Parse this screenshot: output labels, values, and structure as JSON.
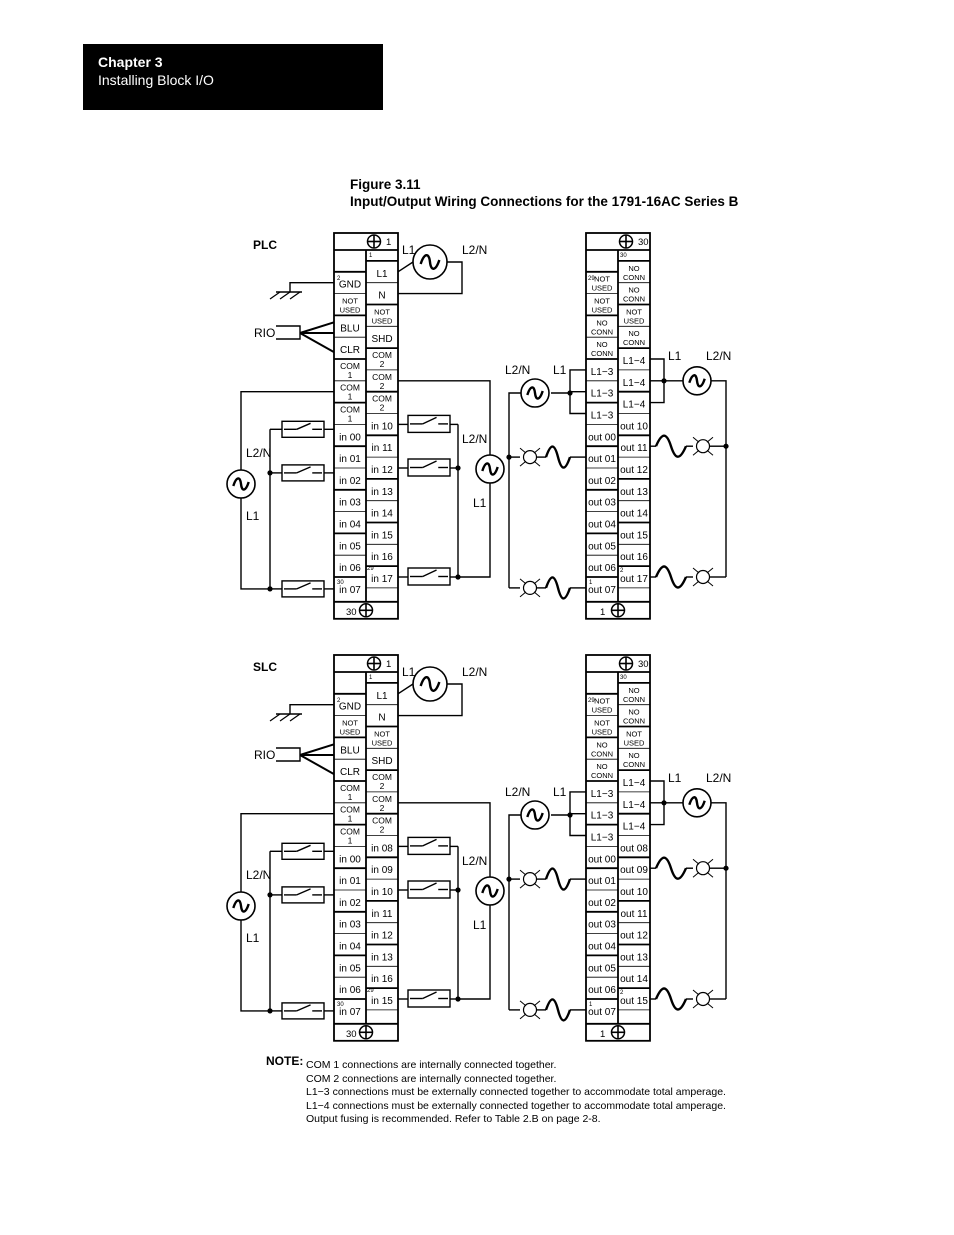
{
  "header": {
    "chapter": "Chapter 3",
    "section": "Installing Block I/O"
  },
  "figure": {
    "number": "Figure 3.11",
    "title": "Input/Output Wiring Connections for the 1791-16AC Series B"
  },
  "colors": {
    "ink": "#000000",
    "paper": "#ffffff",
    "header_bg": "#000000",
    "header_text": "#ffffff"
  },
  "diagrams": [
    {
      "label": "PLC",
      "input_block": {
        "top_screw_label": "1",
        "bottom_screw_label": "30",
        "left_column": [
          "",
          "GND",
          "NOT USED",
          "BLU",
          "CLR",
          "COM 1",
          "COM 1",
          "COM 1",
          "in 00",
          "in 01",
          "in 02",
          "in 03",
          "in 04",
          "in 05",
          "in 06",
          "in 07"
        ],
        "right_column": [
          "L1",
          "N",
          "NOT USED",
          "SHD",
          "COM 2",
          "COM 2",
          "COM 2",
          "in 10",
          "in 11",
          "in 12",
          "in 13",
          "in 14",
          "in 15",
          "in 16",
          "in 17",
          ""
        ],
        "pin_marks": {
          "gnd": "2",
          "l1": "1",
          "in_last_right": "29",
          "in_last_left": "30"
        }
      },
      "output_block": {
        "top_screw_label": "30",
        "bottom_screw_label": "1",
        "left_column": [
          "",
          "NOT USED",
          "NOT USED",
          "NO CONN",
          "NO CONN",
          "L1−3",
          "L1−3",
          "L1−3",
          "out 00",
          "out 01",
          "out 02",
          "out 03",
          "out 04",
          "out 05",
          "out 06",
          "out 07"
        ],
        "right_column": [
          "NO CONN",
          "NO CONN",
          "NOT USED",
          "NO CONN",
          "L1−4",
          "L1−4",
          "L1−4",
          "out 10",
          "out 11",
          "out 12",
          "out 13",
          "out 14",
          "out 15",
          "out 16",
          "out 17",
          ""
        ],
        "pin_marks": {
          "top_left": "29",
          "top_right": "30",
          "bottom_left": "1",
          "bottom_right": "2"
        }
      },
      "labels": {
        "power_l1": "L1",
        "power_l2n": "L2/N",
        "rio": "RIO",
        "in_src_left_top": "L2/N",
        "in_src_left_bottom": "L1",
        "in_src_right_top": "L2/N",
        "in_src_right_bottom": "L1",
        "out_src_left_l2n": "L2/N",
        "out_src_left_l1": "L1",
        "out_src_right_l1": "L1",
        "out_src_right_l2n": "L2/N"
      }
    },
    {
      "label": "SLC",
      "input_block": {
        "top_screw_label": "1",
        "bottom_screw_label": "30",
        "left_column": [
          "",
          "GND",
          "NOT USED",
          "BLU",
          "CLR",
          "COM 1",
          "COM 1",
          "COM 1",
          "in 00",
          "in 01",
          "in 02",
          "in 03",
          "in 04",
          "in 05",
          "in 06",
          "in 07"
        ],
        "right_column": [
          "L1",
          "N",
          "NOT USED",
          "SHD",
          "COM 2",
          "COM 2",
          "COM 2",
          "in 08",
          "in 09",
          "in 10",
          "in 11",
          "in 12",
          "in 13",
          "in 16",
          "in 15",
          ""
        ],
        "pin_marks": {
          "gnd": "2",
          "l1": "1",
          "in_last_right": "29",
          "in_last_left": "30"
        }
      },
      "output_block": {
        "top_screw_label": "30",
        "bottom_screw_label": "1",
        "left_column": [
          "",
          "NOT USED",
          "NOT USED",
          "NO CONN",
          "NO CONN",
          "L1−3",
          "L1−3",
          "L1−3",
          "out 00",
          "out 01",
          "out 02",
          "out 03",
          "out 04",
          "out 05",
          "out 06",
          "out 07"
        ],
        "right_column": [
          "NO CONN",
          "NO CONN",
          "NOT USED",
          "NO CONN",
          "L1−4",
          "L1−4",
          "L1−4",
          "out 08",
          "out 09",
          "out 10",
          "out 11",
          "out 12",
          "out 13",
          "out 14",
          "out 15",
          ""
        ],
        "pin_marks": {
          "top_left": "29",
          "top_right": "30",
          "bottom_left": "1",
          "bottom_right": "2"
        }
      },
      "labels": {
        "power_l1": "L1",
        "power_l2n": "L2/N",
        "rio": "RIO",
        "in_src_left_top": "L2/N",
        "in_src_left_bottom": "L1",
        "in_src_right_top": "L2/N",
        "in_src_right_bottom": "L1",
        "out_src_left_l2n": "L2/N",
        "out_src_left_l1": "L1",
        "out_src_right_l1": "L1",
        "out_src_right_l2n": "L2/N"
      }
    }
  ],
  "note": {
    "label": "NOTE:",
    "lines": [
      "COM 1 connections are internally connected together.",
      "COM 2 connections are internally connected together.",
      "L1−3 connections must be externally connected together to accommodate total amperage.",
      "L1−4 connections must be externally connected together to accommodate total amperage.",
      "Output fusing is recommended.  Refer to Table 2.B on page 2-8."
    ]
  }
}
